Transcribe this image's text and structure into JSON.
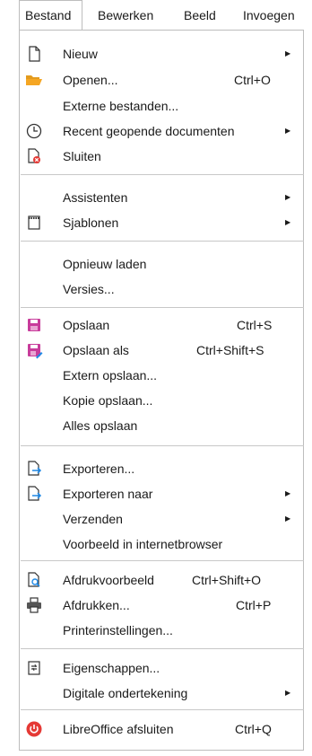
{
  "menubar": {
    "items": [
      {
        "label": "Bestand"
      },
      {
        "label": "Bewerken"
      },
      {
        "label": "Beeld"
      },
      {
        "label": "Invoegen"
      }
    ]
  },
  "file_menu": {
    "items": {
      "new": {
        "label": "Nieuw",
        "icon": "new-document-icon"
      },
      "open": {
        "label": "Openen...",
        "shortcut": "Ctrl+O",
        "icon": "folder-open-icon"
      },
      "remote_files": {
        "label": "Externe bestanden..."
      },
      "recent": {
        "label": "Recent geopende documenten",
        "icon": "clock-icon"
      },
      "close": {
        "label": "Sluiten",
        "icon": "close-document-icon"
      },
      "wizards": {
        "label": "Assistenten"
      },
      "templates": {
        "label": "Sjablonen",
        "icon": "templates-icon"
      },
      "reload": {
        "label": "Opnieuw laden"
      },
      "versions": {
        "label": "Versies..."
      },
      "save": {
        "label": "Opslaan",
        "shortcut": "Ctrl+S",
        "icon": "save-icon"
      },
      "save_as": {
        "label": "Opslaan als",
        "shortcut": "Ctrl+Shift+S",
        "icon": "save-as-icon"
      },
      "save_remote": {
        "label": "Extern opslaan..."
      },
      "save_copy": {
        "label": "Kopie opslaan..."
      },
      "save_all": {
        "label": "Alles opslaan"
      },
      "export": {
        "label": "Exporteren...",
        "icon": "export-icon"
      },
      "export_as": {
        "label": "Exporteren naar",
        "icon": "export-as-icon"
      },
      "send": {
        "label": "Verzenden"
      },
      "preview_browser": {
        "label": "Voorbeeld in internetbrowser"
      },
      "print_preview": {
        "label": "Afdrukvoorbeeld",
        "shortcut": "Ctrl+Shift+O",
        "icon": "print-preview-icon"
      },
      "print": {
        "label": "Afdrukken...",
        "shortcut": "Ctrl+P",
        "icon": "printer-icon"
      },
      "printer_settings": {
        "label": "Printerinstellingen..."
      },
      "properties": {
        "label": "Eigenschappen...",
        "icon": "properties-icon"
      },
      "digital_signatures": {
        "label": "Digitale ondertekening"
      },
      "exit": {
        "label": "LibreOffice afsluiten",
        "shortcut": "Ctrl+Q",
        "icon": "power-icon"
      }
    }
  },
  "colors": {
    "save_accent": "#c83c9b",
    "open_accent": "#f5a623",
    "export_accent": "#1e88e5",
    "close_accent": "#e53935",
    "exit_accent": "#e53935"
  }
}
